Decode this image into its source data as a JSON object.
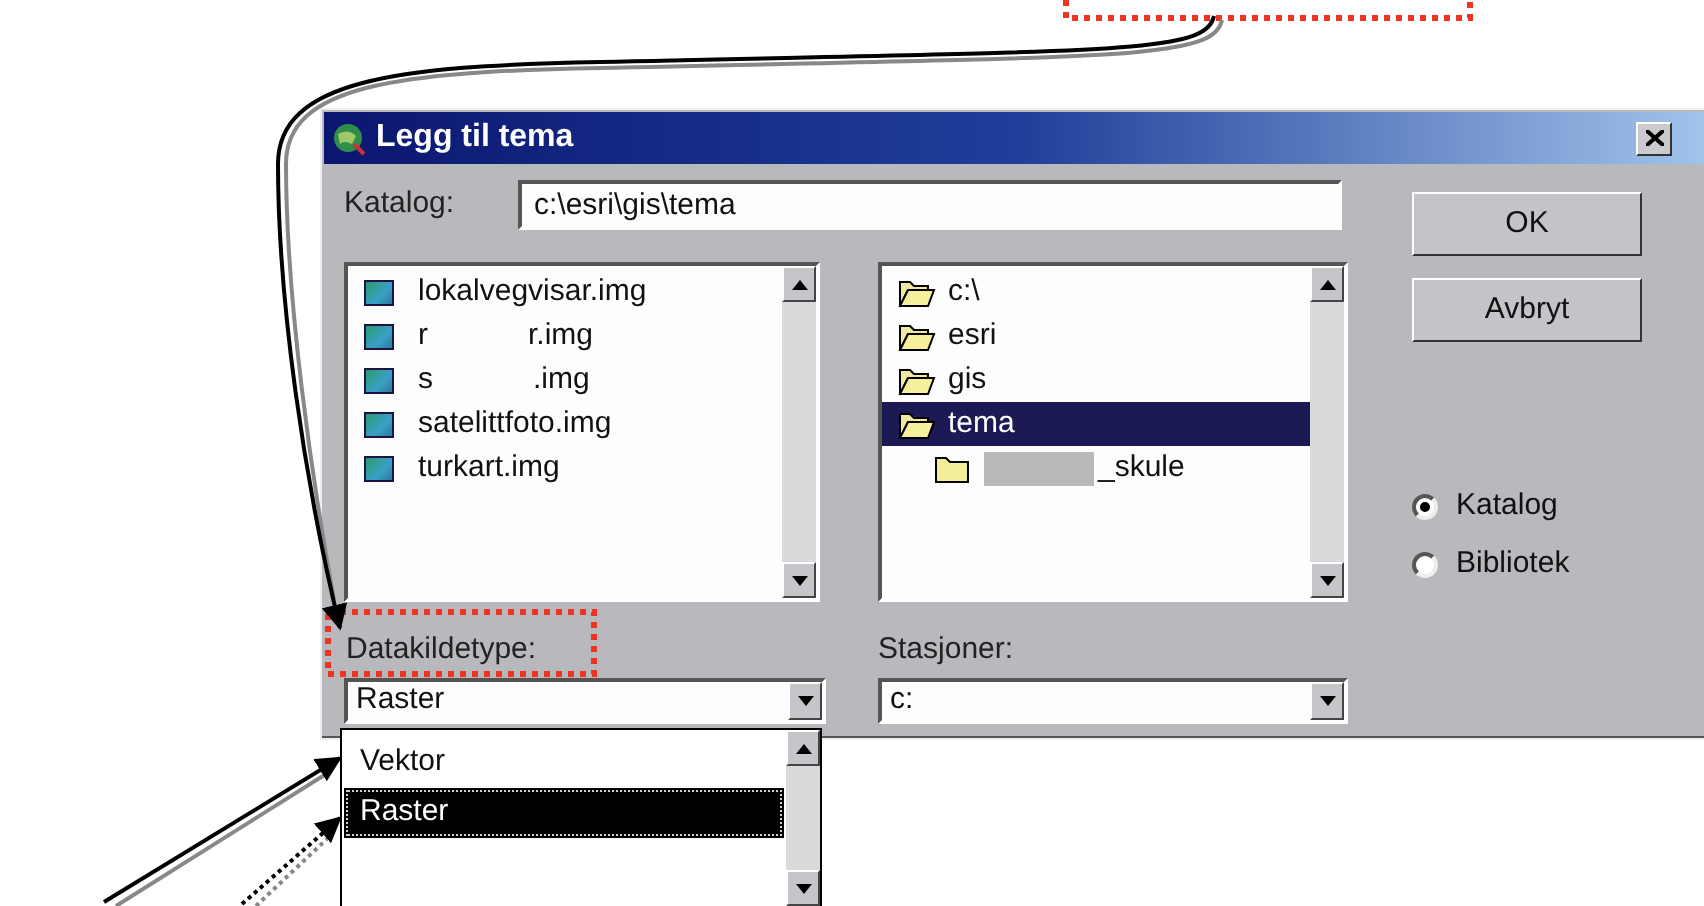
{
  "dialog": {
    "title": "Legg til tema",
    "catalog_label": "Katalog:",
    "catalog_value": "c:\\esri\\gis\\tema",
    "files": [
      {
        "kind": "plain",
        "text": "lokalvegvisar.img"
      },
      {
        "kind": "redacted",
        "text": "r",
        "text_end": "r.img"
      },
      {
        "kind": "redacted",
        "text": "s",
        "text_end": ".img"
      },
      {
        "kind": "plain",
        "text": "satelittfoto.img"
      },
      {
        "kind": "plain",
        "text": "turkart.img"
      }
    ],
    "folders": [
      {
        "name": "c:\\",
        "open": true,
        "selected": false
      },
      {
        "name": "esri",
        "open": true,
        "selected": false
      },
      {
        "name": "gis",
        "open": true,
        "selected": false
      },
      {
        "name": "tema",
        "open": true,
        "selected": true,
        "children": [
          {
            "kind": "redacted",
            "name": "_skule",
            "open": false,
            "selected": false
          }
        ]
      }
    ],
    "buttons": [
      {
        "label": "OK"
      },
      {
        "label": "Avbryt"
      }
    ],
    "location_options": [
      {
        "label": "Katalog",
        "selected": true
      },
      {
        "label": "Bibliotek",
        "selected": false
      }
    ],
    "source_type": {
      "label": "Datakildetype:",
      "value": "Raster",
      "options": [
        {
          "label": "Vektor",
          "selected": false
        },
        {
          "label": "Raster",
          "selected": true
        }
      ]
    },
    "drives": {
      "label": "Stasjoner:",
      "value": "c:"
    }
  }
}
